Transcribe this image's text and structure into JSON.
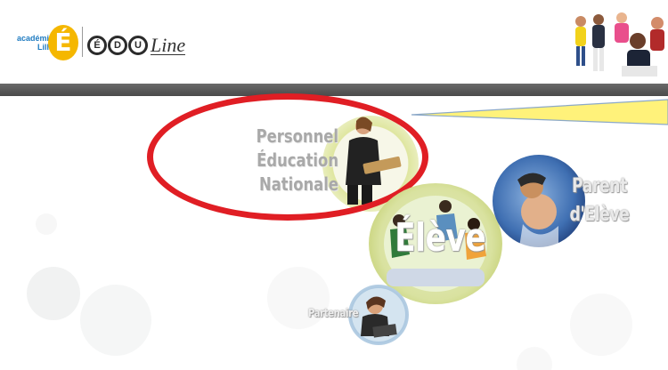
{
  "header": {
    "academie_logo_text_line1": "académie",
    "academie_logo_text_line2": "Lille",
    "academie_logo_letter": "É",
    "eduline_letters": [
      "É",
      "D",
      "U"
    ],
    "eduline_suffix": "Line"
  },
  "portals": {
    "personnel": {
      "line1": "Personnel",
      "line2": "Éducation Nationale"
    },
    "eleve": {
      "label": "Élève"
    },
    "parent": {
      "line1": "Parent",
      "line2": "d'Elève"
    },
    "partenaire": {
      "label": "Partenaire"
    }
  },
  "colors": {
    "highlight": "#e01e24",
    "callout": "#fff27a",
    "header_bar": "#555555",
    "ring_green": "#d6e58c"
  }
}
